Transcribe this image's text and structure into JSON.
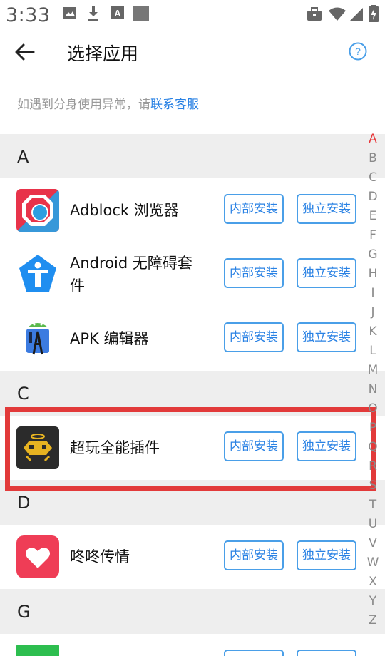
{
  "status_bar": {
    "time": "3:33",
    "icons": [
      "image-icon",
      "download-icon",
      "keyboard-a-icon",
      "square-icon",
      "briefcase-icon",
      "wifi-icon",
      "signal-icon",
      "battery-charging-icon"
    ]
  },
  "header": {
    "title": "选择应用",
    "back_icon": "arrow-left-icon",
    "help_icon": "question-circle-icon"
  },
  "notice": {
    "text": "如遇到分身使用异常，请",
    "link": "联系客服"
  },
  "sections": [
    {
      "letter": "A",
      "apps": [
        {
          "name": "Adblock 浏览器",
          "icon": "adblock-icon"
        },
        {
          "name_line1": "Android 无障碍套",
          "name_line2": "件",
          "icon": "accessibility-icon"
        },
        {
          "name": "APK 编辑器",
          "icon": "apk-editor-icon"
        }
      ]
    },
    {
      "letter": "C",
      "apps": [
        {
          "name": "超玩全能插件",
          "icon": "chaowan-icon"
        }
      ]
    },
    {
      "letter": "D",
      "apps": [
        {
          "name": "咚咚传情",
          "icon": "heart-app-icon"
        }
      ]
    },
    {
      "letter": "G",
      "apps": [
        {
          "name": "",
          "icon": "green-app-icon"
        }
      ]
    }
  ],
  "buttons": {
    "internal_install": "内部安装",
    "independent_install": "独立安装"
  },
  "index_letters": [
    "A",
    "B",
    "C",
    "D",
    "E",
    "F",
    "G",
    "H",
    "I",
    "J",
    "K",
    "L",
    "M",
    "N",
    "O",
    "P",
    "Q",
    "R",
    "S",
    "T",
    "U",
    "V",
    "W",
    "X",
    "Y",
    "Z"
  ],
  "index_active": "A",
  "colors": {
    "accent": "#2a82e4",
    "highlight_border": "#e23a3a",
    "index_active": "#e8373a",
    "section_bg": "#eeeeee"
  }
}
